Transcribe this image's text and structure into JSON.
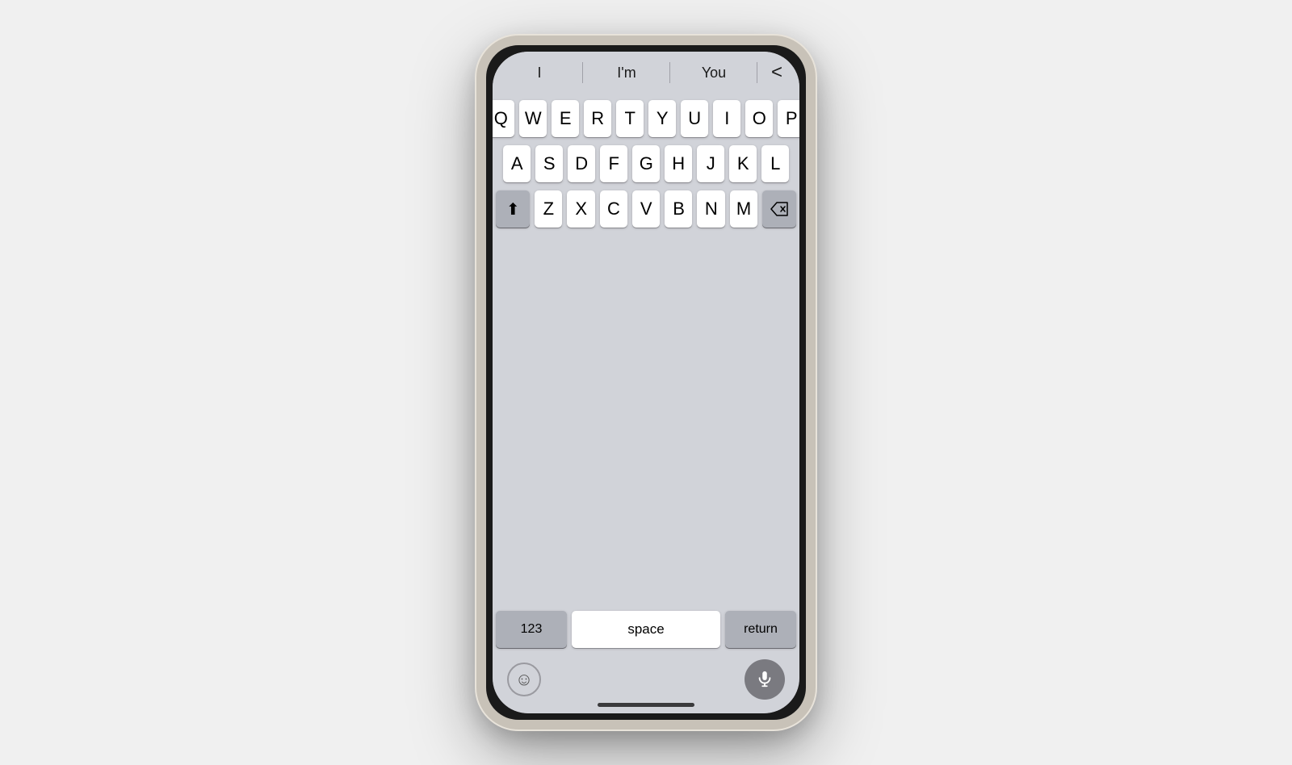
{
  "background": "#f0f0f0",
  "phone": {
    "frame_color": "#c8c2b8"
  },
  "suggestions": {
    "items": [
      "I",
      "I'm",
      "You"
    ],
    "back_label": "<"
  },
  "keyboard": {
    "rows": [
      [
        "Q",
        "W",
        "E",
        "R",
        "T",
        "Y",
        "U",
        "I",
        "O",
        "P"
      ],
      [
        "A",
        "S",
        "D",
        "F",
        "G",
        "H",
        "J",
        "K",
        "L"
      ],
      [
        "Z",
        "X",
        "C",
        "V",
        "B",
        "N",
        "M"
      ]
    ],
    "shift_label": "⬆",
    "delete_label": "⌫",
    "numbers_label": "123",
    "space_label": "space",
    "return_label": "return"
  },
  "accessory": {
    "emoji_label": "😊",
    "mic_label": "mic"
  }
}
